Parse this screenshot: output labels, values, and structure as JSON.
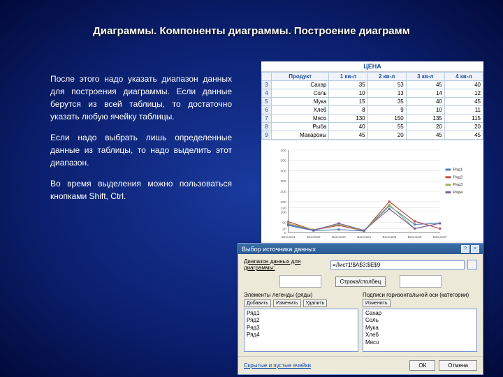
{
  "title": "Диаграммы. Компоненты диаграммы. Построение диаграмм",
  "para1": "После этого надо указать диапазон данных для построения диаграммы. Если данные берутся из всей таблицы, то достаточно указать любую ячейку таблицы.",
  "para2": "Если надо выбрать лишь определенные данные из таблицы, то надо выделить этот диапазон.",
  "para3": "Во время выделения можно пользоваться кнопками Shift, Ctrl.",
  "sheet_title": "ЦЕНА",
  "chart_data": {
    "type": "line",
    "categories": [
      "Сахар",
      "Соль",
      "Мука",
      "Хлеб",
      "Мясо",
      "Рыба",
      "Макароны"
    ],
    "x_index": [
      1,
      2,
      3,
      4,
      5,
      6,
      7
    ],
    "series": [
      {
        "name": "Ряд1",
        "color": "#4a7ebb",
        "values": [
          35,
          10,
          15,
          8,
          130,
          40,
          45
        ]
      },
      {
        "name": "Ряд2",
        "color": "#be4b48",
        "values": [
          53,
          13,
          35,
          9,
          150,
          55,
          20
        ]
      },
      {
        "name": "Ряд3",
        "color": "#98b954",
        "values": [
          45,
          14,
          40,
          10,
          135,
          20,
          45
        ]
      },
      {
        "name": "Ряд4",
        "color": "#7d60a0",
        "values": [
          40,
          12,
          45,
          11,
          115,
          20,
          45
        ]
      }
    ],
    "ylim": [
      0,
      400
    ],
    "yticks": [
      0,
      20,
      50,
      100,
      120,
      150,
      200,
      250,
      300,
      350,
      400
    ],
    "xticks": [
      "Вателия1",
      "Вателия2",
      "Вателия3",
      "Вателия4",
      "Вателия5",
      "Вателия6",
      "Вателия7"
    ]
  },
  "table": {
    "headers": [
      "Продукт",
      "1 кв-л",
      "2 кв-л",
      "3 кв-л",
      "4 кв-л"
    ],
    "rows": [
      [
        "Сахар",
        35,
        53,
        45,
        40
      ],
      [
        "Соль",
        10,
        13,
        14,
        12
      ],
      [
        "Мука",
        15,
        35,
        40,
        45
      ],
      [
        "Хлеб",
        8,
        9,
        10,
        11
      ],
      [
        "Мясо",
        130,
        150,
        135,
        115
      ],
      [
        "Рыба",
        40,
        55,
        20,
        20
      ],
      [
        "Макароны",
        45,
        20,
        45,
        45
      ]
    ]
  },
  "dialog": {
    "title": "Выбор источника данных",
    "range_label": "Диапазон данных для диаграммы:",
    "range_value": "=Лист1!$A$3:$E$9",
    "swap_btn": "Строка/столбец",
    "left_hdr": "Элементы легенды (ряды)",
    "right_hdr": "Подписи горизонтальной оси (категории)",
    "add_btn": "Добавить",
    "edit_btn": "Изменить",
    "del_btn": "Удалить",
    "edit_btn2": "Изменить",
    "left_list": [
      "Ряд1",
      "Ряд2",
      "Ряд3",
      "Ряд4"
    ],
    "right_list": [
      "Сахар",
      "Соль",
      "Мука",
      "Хлеб",
      "Мясо"
    ],
    "hidden_link": "Скрытые и пустые ячейки",
    "ok": "ОК",
    "cancel": "Отмена"
  }
}
